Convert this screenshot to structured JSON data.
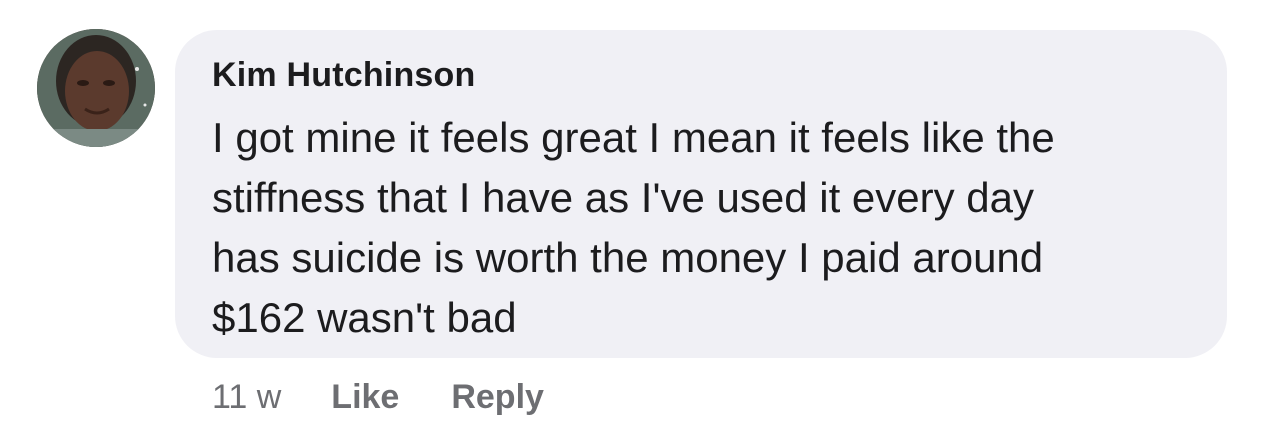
{
  "comment": {
    "author": "Kim Hutchinson",
    "avatar_icon": "profile-photo",
    "text_lines": [
      "I got mine it feels great I mean it feels like the",
      "stiffness that I have as I've used it every day",
      "has suicide is worth the money I paid around",
      "$162 wasn't bad"
    ],
    "time_ago": "11 w",
    "like_label": "Like",
    "reply_label": "Reply"
  },
  "colors": {
    "bubble_background": "#f0f0f5",
    "primary_text": "#1c1c1e",
    "secondary_text": "#6d6e72"
  }
}
